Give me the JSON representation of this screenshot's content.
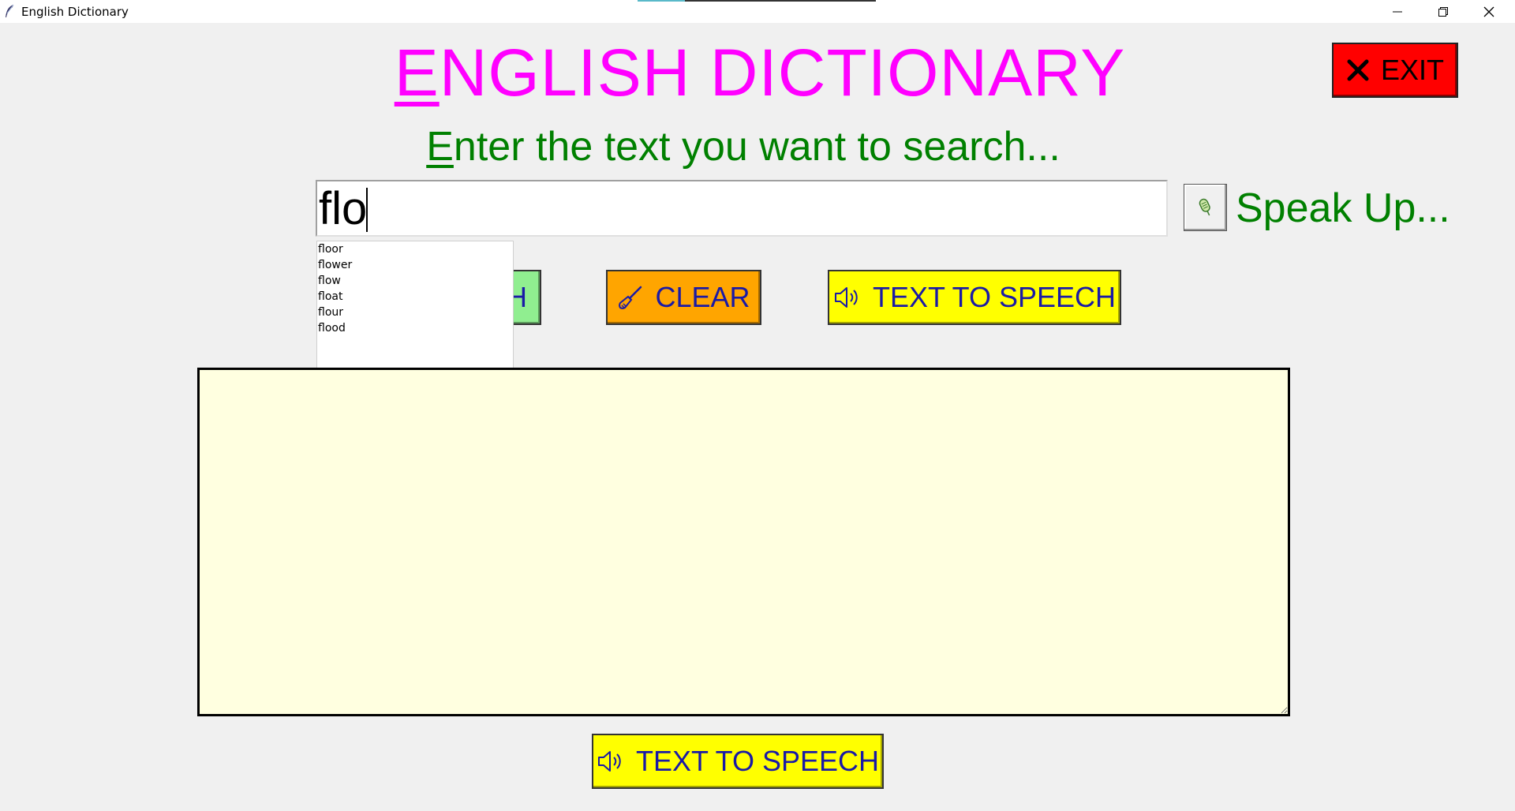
{
  "window": {
    "title": "English Dictionary",
    "controls": {
      "minimize": "minimize-icon",
      "maximize": "restore-icon",
      "close": "close-icon"
    }
  },
  "header": {
    "title_first": "E",
    "title_rest": "NGLISH DICTIONARY",
    "title_color": "#ff00ff",
    "exit_label": "EXIT"
  },
  "prompt": {
    "first": "E",
    "rest": "nter the text you want to search...",
    "color": "#008000"
  },
  "search": {
    "value": "flo",
    "speak_label": "Speak Up..."
  },
  "suggestions": [
    "floor",
    "flower",
    "flow",
    "float",
    "flour",
    "flood"
  ],
  "buttons": {
    "search_visible": "H",
    "clear": "CLEAR",
    "tts_top": "TEXT TO SPEECH",
    "tts_bottom": "TEXT TO SPEECH"
  },
  "result": {
    "text": ""
  },
  "colors": {
    "exit": "#ff0000",
    "search_btn": "#90ee90",
    "clear_btn": "#ffa500",
    "tts_btn": "#ffff00",
    "result_bg": "#ffffe0",
    "button_text": "#1a1aa6"
  }
}
